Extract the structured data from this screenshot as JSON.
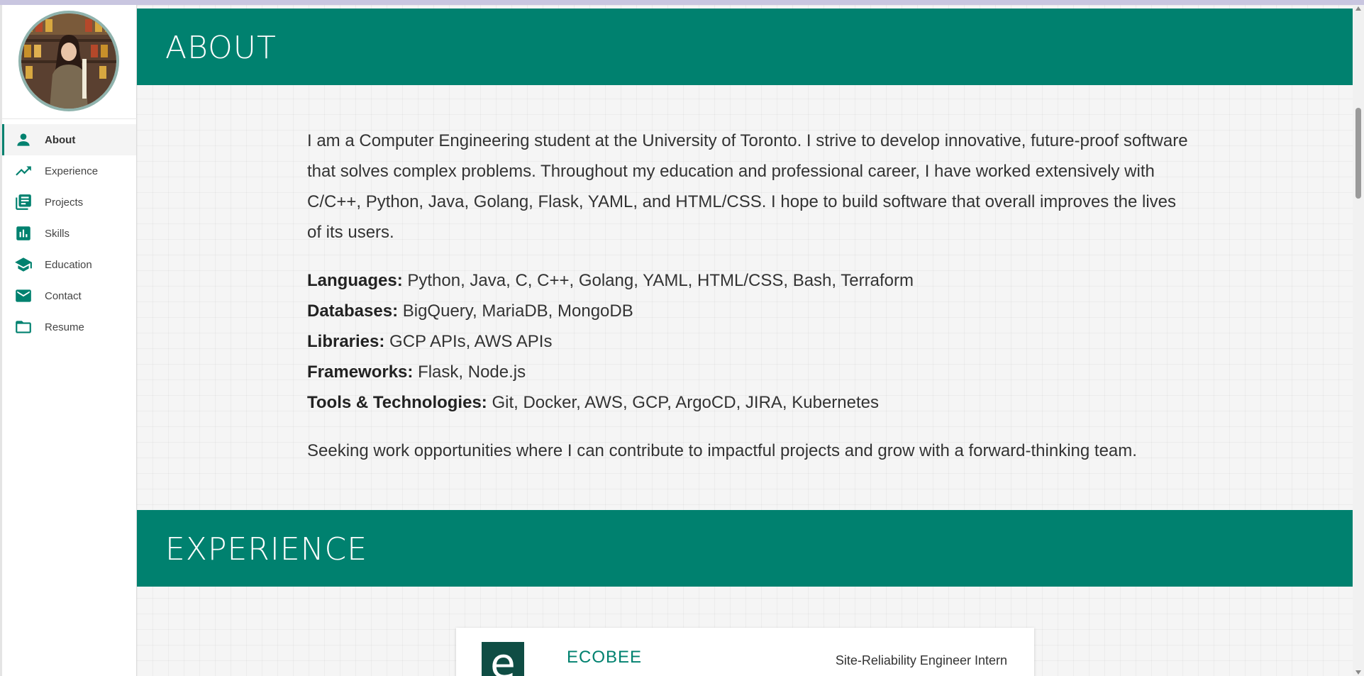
{
  "sidebar": {
    "avatar_alt": "profile photo",
    "items": [
      {
        "label": "About",
        "icon": "person-icon",
        "active": true
      },
      {
        "label": "Experience",
        "icon": "trending-up-icon",
        "active": false
      },
      {
        "label": "Projects",
        "icon": "library-books-icon",
        "active": false
      },
      {
        "label": "Skills",
        "icon": "bar-chart-icon",
        "active": false
      },
      {
        "label": "Education",
        "icon": "graduation-cap-icon",
        "active": false
      },
      {
        "label": "Contact",
        "icon": "email-icon",
        "active": false
      },
      {
        "label": "Resume",
        "icon": "folder-icon",
        "active": false
      }
    ]
  },
  "about": {
    "title": "ABOUT",
    "intro": "I am a Computer Engineering student at the University of Toronto. I strive to develop innovative, future-proof software that solves complex problems. Throughout my education and professional career, I have worked extensively with C/C++, Python, Java, Golang, Flask, YAML, and HTML/CSS. I hope to build software that overall improves the lives of its users.",
    "skills": [
      {
        "key": "Languages:",
        "value": "Python, Java, C, C++, Golang, YAML, HTML/CSS, Bash, Terraform"
      },
      {
        "key": "Databases:",
        "value": "BigQuery, MariaDB, MongoDB"
      },
      {
        "key": "Libraries:",
        "value": "GCP APIs, AWS APIs"
      },
      {
        "key": "Frameworks:",
        "value": "Flask, Node.js"
      },
      {
        "key": "Tools & Technologies:",
        "value": "Git, Docker, AWS, GCP, ArgoCD, JIRA, Kubernetes"
      }
    ],
    "seeking": "Seeking work opportunities where I can contribute to impactful projects and grow with a forward-thinking team."
  },
  "experience": {
    "title": "EXPERIENCE",
    "items": [
      {
        "company": "ECOBEE",
        "logo_letter": "e",
        "role": "Site-Reliability Engineer Intern"
      }
    ]
  },
  "colors": {
    "accent": "#00816f",
    "background": "#f5f5f5",
    "logo": "#0f4d44"
  }
}
